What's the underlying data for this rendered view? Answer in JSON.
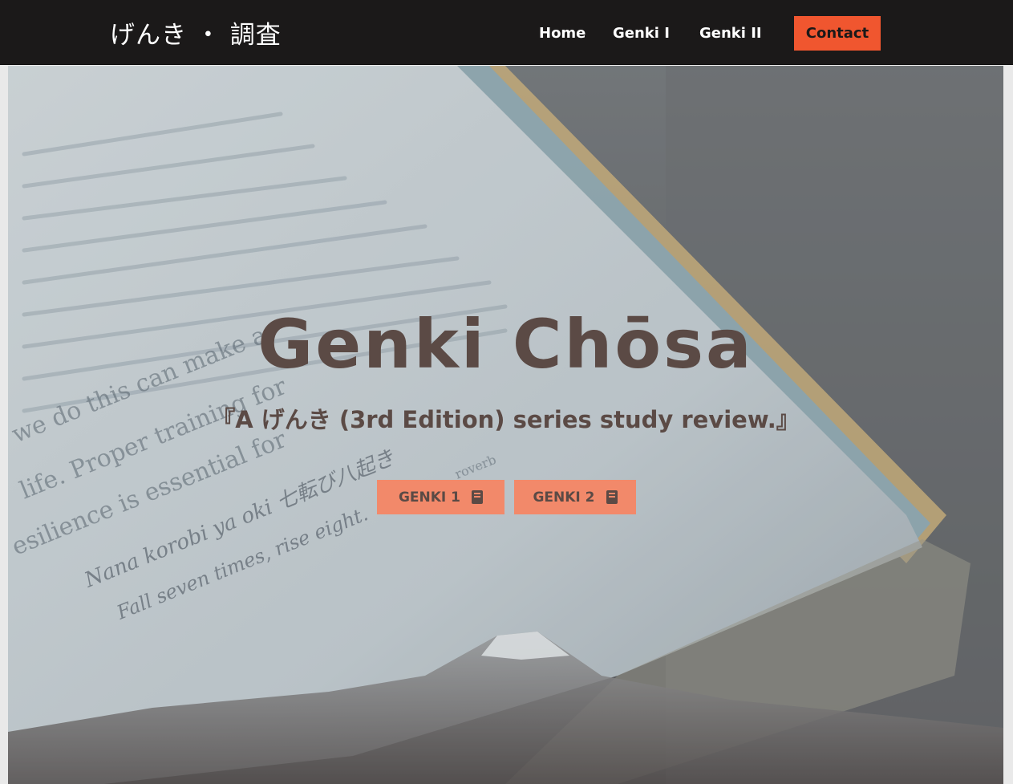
{
  "navbar": {
    "brand": "げんき ・ 調査",
    "links": [
      {
        "label": "Home"
      },
      {
        "label": "Genki I"
      },
      {
        "label": "Genki II"
      }
    ],
    "contact_label": "Contact",
    "accent_color": "#f0562f",
    "background_color": "#1b1919"
  },
  "hero": {
    "title": "Genki Chōsa",
    "subtitle": "『A げんき (3rd Edition) series study review.』",
    "title_color": "#5b4a45",
    "buttons": [
      {
        "label": "GENKI 1",
        "icon": "book-icon"
      },
      {
        "label": "GENKI 2",
        "icon": "book-icon"
      }
    ],
    "button_color": "#f2896a",
    "background_text": {
      "line1": "Nana korobi ya oki 七転び八起き",
      "line2": "Fall seven times, rise eight.",
      "line3": "we do this can make a",
      "line4": "life. Proper training for",
      "line5": "esilience is essential for",
      "line6": "roverb"
    }
  }
}
